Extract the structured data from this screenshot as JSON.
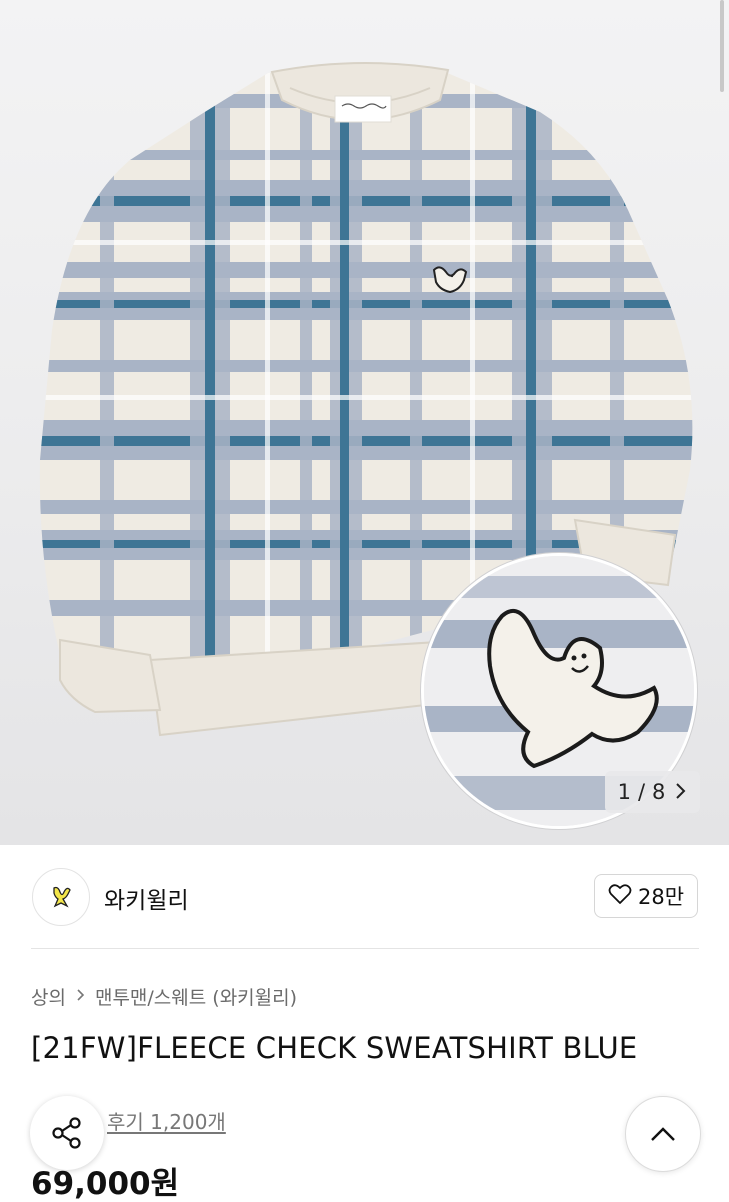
{
  "gallery": {
    "current": "1",
    "separator": "/",
    "total": "8",
    "next_icon": "chevron-right-icon"
  },
  "brand": {
    "name": "와키윌리",
    "logo_icon": "brand-logo-icon"
  },
  "like": {
    "icon": "heart-outline-icon",
    "count": "28만"
  },
  "breadcrumb": {
    "category": "상의",
    "separator_icon": "chevron-right-icon",
    "subcategory": "맨투맨/스웨트 (와키윌리)"
  },
  "product": {
    "title": "[21FW]FLEECE CHECK SWEATSHIRT BLUE",
    "reviews": "후기 1,200개",
    "price": "69,000원"
  },
  "actions": {
    "share_icon": "share-icon",
    "scroll_top_icon": "chevron-up-icon"
  },
  "colors": {
    "plaid_blue": "#3e7595",
    "plaid_grey": "#a9b4c6",
    "cream": "#efebe3",
    "like_border": "#d6d6d6"
  }
}
